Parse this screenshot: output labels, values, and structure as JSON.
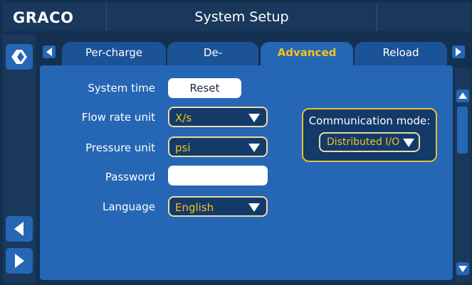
{
  "header": {
    "logo": "GRACO",
    "title": "System Setup"
  },
  "tabs": [
    {
      "label": "Per-charge",
      "active": false
    },
    {
      "label": "De-pressurization",
      "active": false
    },
    {
      "label": "Advanced",
      "active": true
    },
    {
      "label": "Reload",
      "active": false
    }
  ],
  "form": {
    "system_time": {
      "label": "System time",
      "button_label": "Reset"
    },
    "flow_rate_unit": {
      "label": "Flow rate unit",
      "value": "X/s"
    },
    "pressure_unit": {
      "label": "Pressure unit",
      "value": "psi"
    },
    "password": {
      "label": "Password",
      "value": ""
    },
    "language": {
      "label": "Language",
      "value": "English"
    }
  },
  "communication": {
    "label": "Communication mode:",
    "value": "Distributed I/O"
  },
  "icons": {
    "home": "graco-logo-icon",
    "prev": "triangle-left-icon",
    "next": "triangle-right-icon",
    "tab_prev": "triangle-left-icon",
    "tab_next": "triangle-right-icon",
    "scroll_up": "triangle-up-icon",
    "scroll_down": "triangle-down-icon",
    "dropdown": "triangle-down-icon"
  },
  "colors": {
    "background": "#143050",
    "chrome": "#19385c",
    "panel": "#2566b5",
    "tab_inactive": "#1c5296",
    "accent_text": "#f5c21b",
    "dropdown_fill": "#143a6a",
    "comm_border": "#e8be3a"
  }
}
